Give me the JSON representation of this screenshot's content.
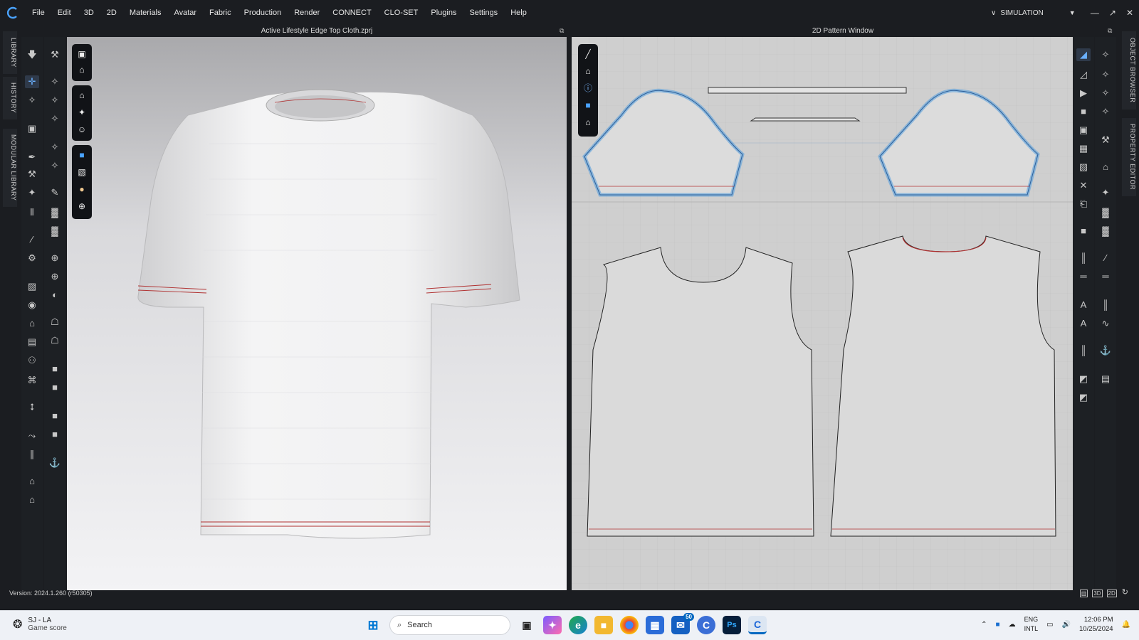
{
  "menu": {
    "items": [
      "File",
      "Edit",
      "3D",
      "2D",
      "Materials",
      "Avatar",
      "Fabric",
      "Production",
      "Render",
      "CONNECT",
      "CLO-SET",
      "Plugins",
      "Settings",
      "Help"
    ],
    "simulation_label": "SIMULATION"
  },
  "left_tabs": [
    "LIBRARY",
    "HISTORY",
    "MODULAR LIBRARY"
  ],
  "right_tabs": [
    "OBJECT BROWSER",
    "PROPERTY EDITOR"
  ],
  "window3d": {
    "title": "Active Lifestyle Edge Top Cloth.zprj"
  },
  "window2d": {
    "title": "2D Pattern Window"
  },
  "status": {
    "version": "Version: 2024.1.260 (r50305)",
    "view_buttons": [
      "3D",
      "2D"
    ]
  },
  "taskbar": {
    "weather_title": "SJ - LA",
    "weather_sub": "Game score",
    "search_placeholder": "Search",
    "mail_badge": "50",
    "ps_label": "Ps",
    "lang_line1": "ENG",
    "lang_line2": "INTL",
    "time": "12:06 PM",
    "date": "10/25/2024"
  },
  "colors": {
    "accent_blue": "#5aa0dc",
    "seam_red": "#b03030",
    "app_bg": "#1b1d21"
  }
}
